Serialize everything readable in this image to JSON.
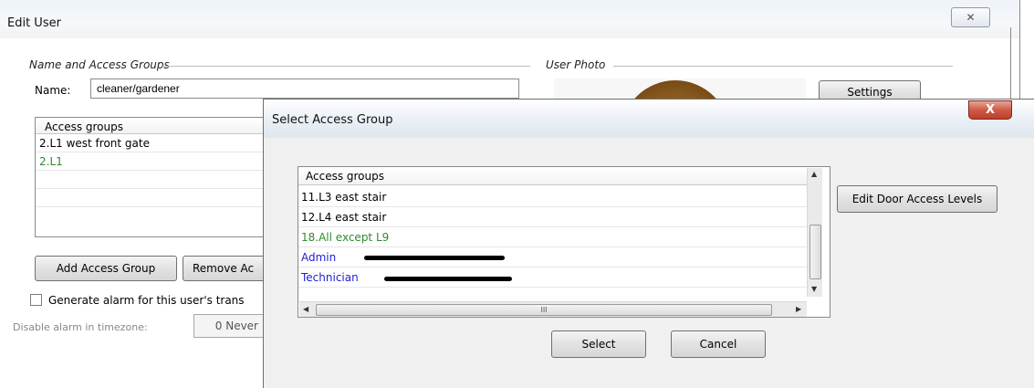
{
  "edit_user": {
    "title": "Edit User",
    "close_glyph": "✕",
    "name_group_label": "Name and Access Groups",
    "name_label": "Name:",
    "name_value": "cleaner/gardener",
    "access_groups_header": "Access groups",
    "access_groups": [
      {
        "label": "2.L1 west front gate",
        "color": "#000000"
      },
      {
        "label": "2.L1",
        "color": "#2e8b2e"
      }
    ],
    "add_group_button": "Add Access Group",
    "remove_group_button": "Remove Ac",
    "alarm_checkbox_label": "Generate alarm for this user's trans",
    "alarm_checked": false,
    "disable_alarm_label": "Disable alarm in timezone:",
    "timezone_value": "0 Never",
    "photo_group_label": "User Photo",
    "settings_button": "Settings"
  },
  "select_dialog": {
    "title": "Select Access Group",
    "close_glyph": "X",
    "list_header": "Access groups",
    "items": [
      {
        "label": "11.L3 east stair",
        "color": "#000000",
        "redacted": false
      },
      {
        "label": "12.L4 east stair",
        "color": "#000000",
        "redacted": false
      },
      {
        "label": "18.All except L9",
        "color": "#2e8b2e",
        "redacted": false
      },
      {
        "label": "Admin",
        "color": "#1e1ecf",
        "redacted": true
      },
      {
        "label": "Technician",
        "color": "#1e1ecf",
        "redacted": true
      }
    ],
    "hscroll_grip": "III",
    "edit_levels_button": "Edit Door Access Levels",
    "select_button": "Select",
    "cancel_button": "Cancel"
  },
  "colors": {
    "green_item": "#2e8b2e",
    "blue_item": "#1e1ecf",
    "close_red": "#c03d28"
  }
}
